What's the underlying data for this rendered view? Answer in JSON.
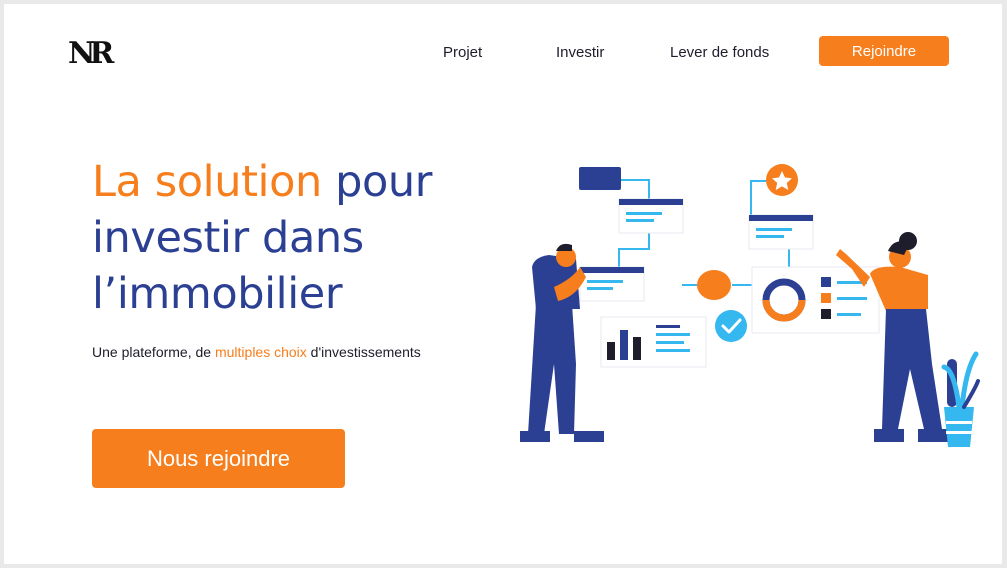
{
  "brand": {
    "logo_text": "NR"
  },
  "nav": {
    "items": [
      {
        "label": "Projet"
      },
      {
        "label": "Investir"
      },
      {
        "label": "Lever de fonds"
      }
    ],
    "cta_label": "Rejoindre"
  },
  "hero": {
    "title_accent": "La solution",
    "title_rest_1": " pour",
    "title_line_2": "investir dans",
    "title_line_3": "l’immobilier",
    "subtitle_before": "Une plateforme, de ",
    "subtitle_accent": "multiples choix",
    "subtitle_after": " d'investissements",
    "cta_label": "Nous rejoindre"
  },
  "colors": {
    "accent": "#f77e1c",
    "primary": "#2b3f93",
    "light_blue": "#35b7f0",
    "text": "#1d1d2b"
  },
  "illustration": {
    "icons": [
      "star-icon",
      "check-icon",
      "donut-chart-icon",
      "bar-chart-icon",
      "plant-icon"
    ]
  }
}
